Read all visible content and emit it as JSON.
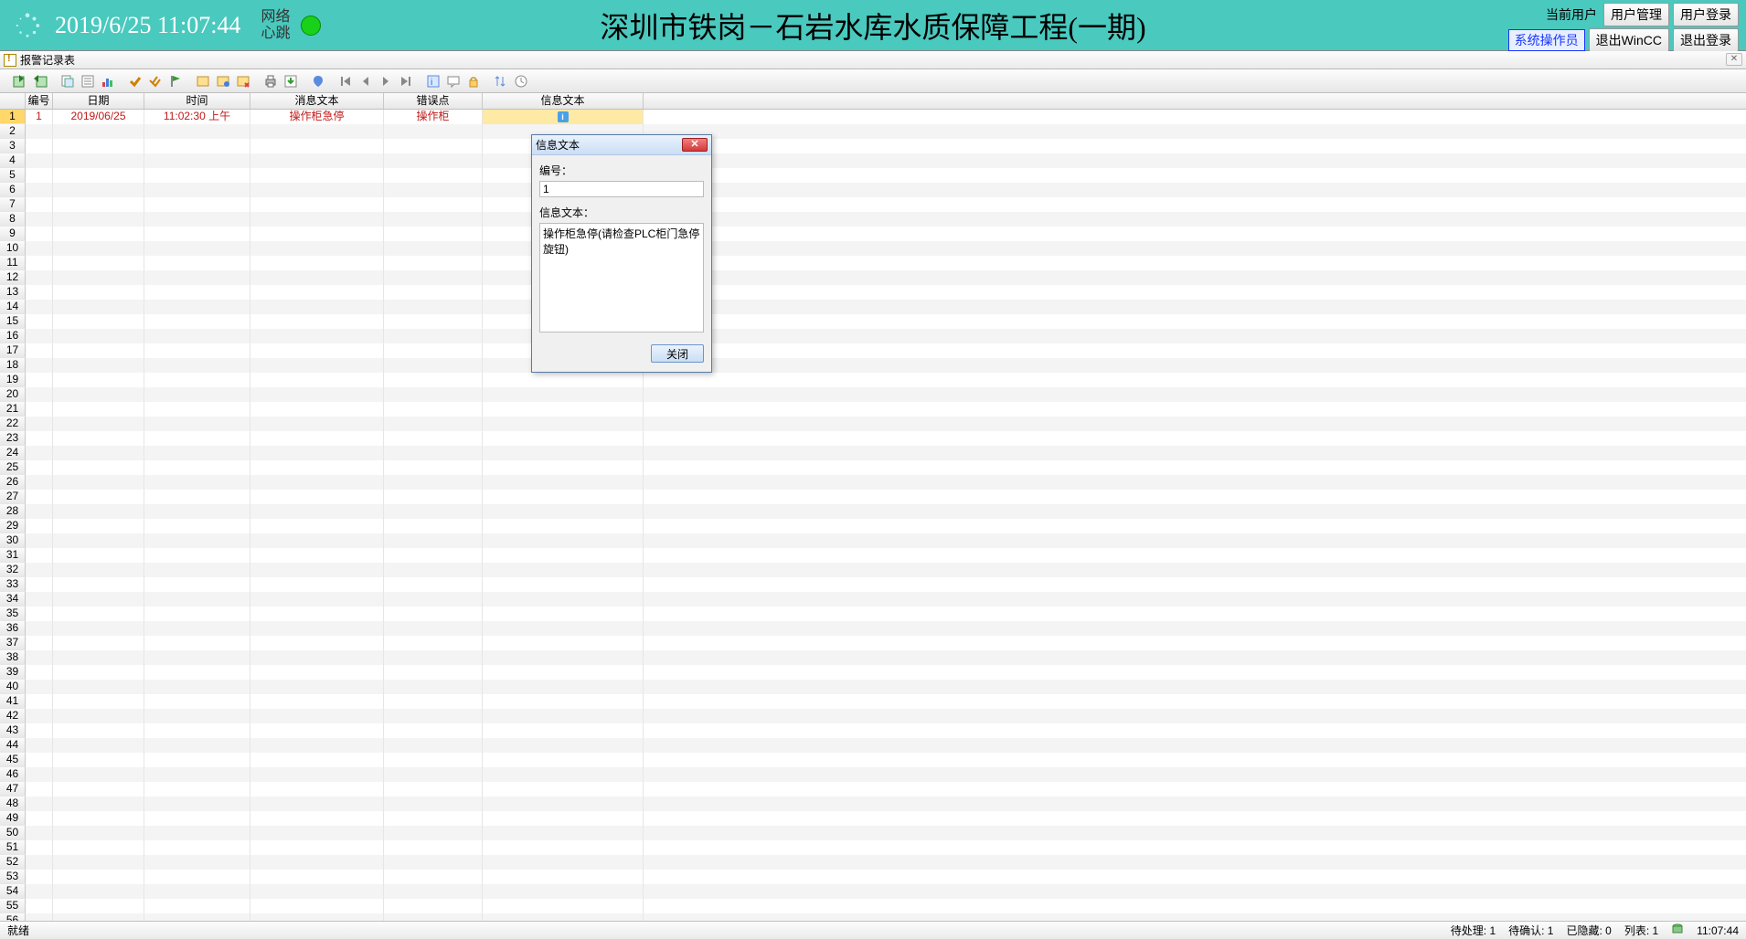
{
  "header": {
    "datetime": "2019/6/25 11:07:44",
    "network_label": "网络\n心跳",
    "title": "深圳市铁岗－石岩水库水质保障工程(一期)",
    "current_user_label": "当前用户",
    "role": "系统操作员",
    "btn_user_mgmt": "用户管理",
    "btn_user_login": "用户登录",
    "btn_exit_wincc": "退出WinCC",
    "btn_exit_login": "退出登录"
  },
  "window": {
    "title": "报警记录表"
  },
  "columns": [
    "编号",
    "日期",
    "时间",
    "消息文本",
    "错误点",
    "信息文本"
  ],
  "row1": {
    "num": "1",
    "id": "1",
    "date": "2019/06/25",
    "time": "11:02:30 上午",
    "msg": "操作柜急停",
    "err": "操作柜"
  },
  "dialog": {
    "title": "信息文本",
    "label_id": "编号：",
    "id_value": "1",
    "label_text": "信息文本：",
    "text_value": "操作柜急停(请检查PLC柜门急停旋钮)",
    "close": "关闭"
  },
  "status": {
    "ready": "就绪",
    "pending": "待处理: 1",
    "toack": "待确认: 1",
    "hidden": "已隐藏: 0",
    "list": "列表: 1",
    "clock": "11:07:44"
  },
  "row_count": 57
}
